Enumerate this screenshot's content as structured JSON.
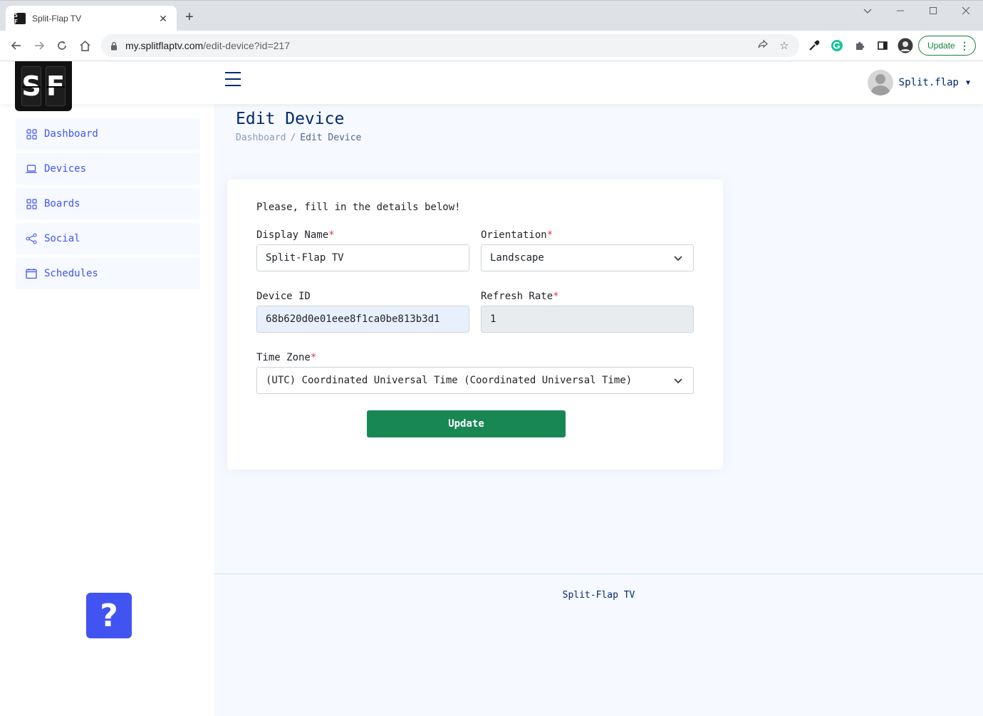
{
  "browser": {
    "tab_title": "Split-Flap TV",
    "favicon_text": "S F",
    "url_host": "my.splitflaptv.com",
    "url_path": "/edit-device?id=217",
    "update_label": "Update"
  },
  "header": {
    "logo_left": "S",
    "logo_right": "F",
    "user_name": "Split.flap"
  },
  "sidebar": {
    "items": [
      {
        "label": "Dashboard",
        "icon": "grid-icon"
      },
      {
        "label": "Devices",
        "icon": "laptop-icon"
      },
      {
        "label": "Boards",
        "icon": "grid-icon"
      },
      {
        "label": "Social",
        "icon": "share-icon"
      },
      {
        "label": "Schedules",
        "icon": "calendar-icon"
      }
    ],
    "help_label": "?"
  },
  "page": {
    "title": "Edit Device",
    "breadcrumb": {
      "root": "Dashboard",
      "sep": "/",
      "current": "Edit Device"
    }
  },
  "form": {
    "intro": "Please, fill in the details below!",
    "display_name": {
      "label": "Display Name",
      "required": "*",
      "value": "Split-Flap TV"
    },
    "orientation": {
      "label": "Orientation",
      "required": "*",
      "value": "Landscape"
    },
    "device_id": {
      "label": "Device ID",
      "value": "68b620d0e01eee8f1ca0be813b3d1"
    },
    "refresh_rate": {
      "label": "Refresh Rate",
      "required": "*",
      "value": "1"
    },
    "time_zone": {
      "label": "Time Zone",
      "required": "*",
      "value": "(UTC) Coordinated Universal Time (Coordinated Universal Time)"
    },
    "submit_label": "Update"
  },
  "footer": {
    "text": "Split-Flap TV"
  },
  "colors": {
    "accent": "#4154f1",
    "title": "#012970",
    "submit": "#198754",
    "required": "#dc3545",
    "main_bg": "#f6f9ff"
  }
}
